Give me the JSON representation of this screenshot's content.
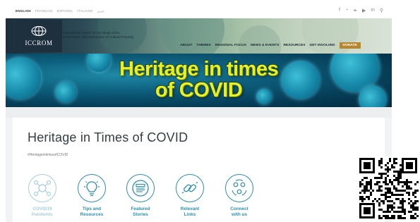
{
  "languages": [
    {
      "label": "ENGLISH",
      "active": true
    },
    {
      "label": "FRANÇAIS",
      "active": false
    },
    {
      "label": "ESPAÑOL",
      "active": false
    },
    {
      "label": "ITALIANO",
      "active": false
    },
    {
      "label": "عربي",
      "active": false
    }
  ],
  "social_icons": [
    "facebook-icon",
    "rss-icon",
    "twitter-icon",
    "youtube-icon",
    "linkedin-icon",
    "search-icon"
  ],
  "social_glyphs": [
    "f",
    "◔",
    "❧",
    "▶",
    "in",
    "⚲"
  ],
  "logo": {
    "text": "ICCROM"
  },
  "organization": {
    "line1": "International Centre for the Study of the",
    "line2": "Preservation and Restoration of Cultural Property"
  },
  "nav": {
    "items": [
      "ABOUT",
      "THEMES",
      "REGIONAL FOCUS",
      "NEWS & EVENTS",
      "RESOURCES",
      "GET INVOLVED"
    ],
    "donate": "DONATE"
  },
  "banner": {
    "line1": "Heritage in times",
    "line2": "of COVID"
  },
  "page": {
    "title": "Heritage in Times of COVID",
    "hashtag": "#HeritageintimesofCOVID"
  },
  "tiles": [
    {
      "line1": "COVID19",
      "line2": "Pandemic",
      "icon": "virus-network-icon",
      "dim": true
    },
    {
      "line1": "Tips and",
      "line2": "Resources",
      "icon": "lightbulb-icon",
      "dim": false
    },
    {
      "line1": "Featured",
      "line2": "Stories",
      "icon": "newspaper-icon",
      "dim": false
    },
    {
      "line1": "Relevant",
      "line2": "Links",
      "icon": "link-icon",
      "dim": false
    },
    {
      "line1": "Connect",
      "line2": "with us",
      "icon": "people-connect-icon",
      "dim": false
    }
  ],
  "colors": {
    "accent": "#2a8fb1",
    "accent_dim": "#a7cedc",
    "donate": "#b8862e",
    "banner_text": "#e6ef2a",
    "logo_bg": "#1e2f3d"
  }
}
